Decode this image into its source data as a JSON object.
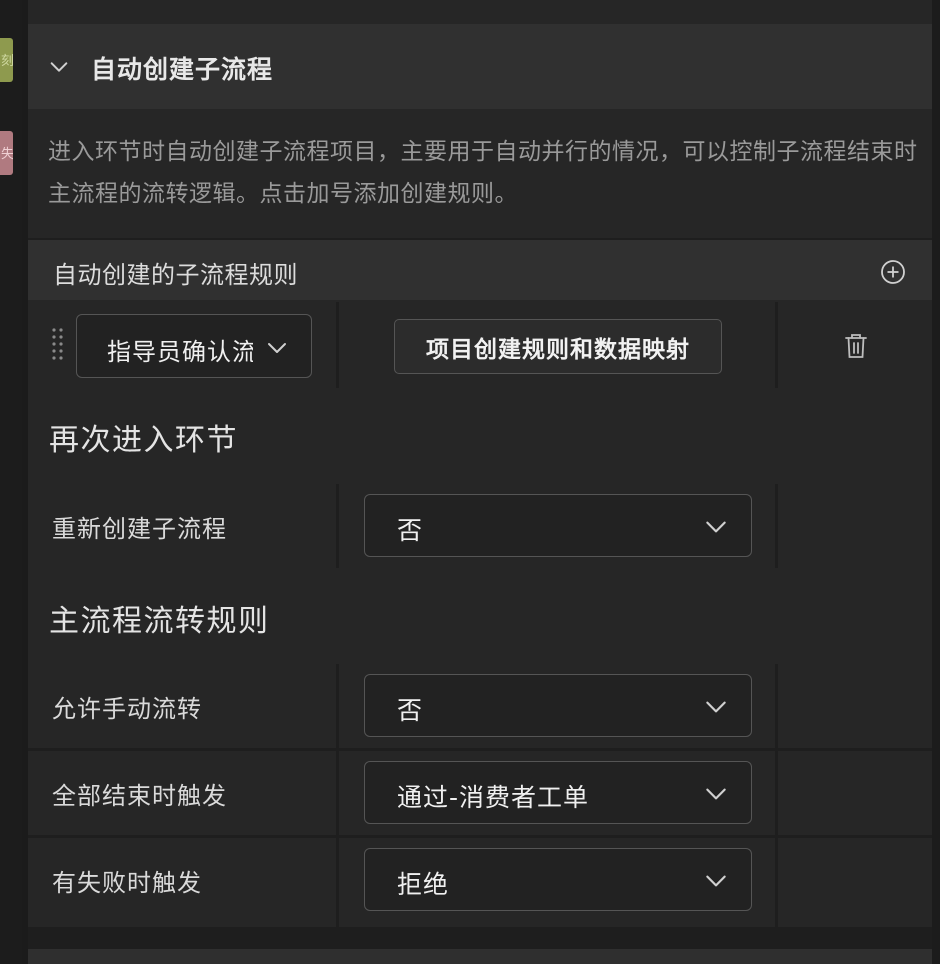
{
  "gutter": {
    "stub_top": "刻",
    "stub_bottom": "失"
  },
  "section": {
    "title": "自动创建子流程"
  },
  "description": "进入环节时自动创建子流程项目，主要用于自动并行的情况，可以控制子流程结束时主流程的流转逻辑。点击加号添加创建规则。",
  "rules": {
    "title": "自动创建的子流程规则",
    "items": [
      {
        "route": "指导员确认流",
        "mapping_button": "项目创建规则和数据映射"
      }
    ]
  },
  "reenter": {
    "heading": "再次进入环节",
    "fields": [
      {
        "label": "重新创建子流程",
        "value": "否"
      }
    ]
  },
  "main_flow": {
    "heading": "主流程流转规则",
    "fields": [
      {
        "label": "允许手动流转",
        "value": "否"
      },
      {
        "label": "全部结束时触发",
        "value": "通过-消费者工单"
      },
      {
        "label": "有失败时触发",
        "value": "拒绝"
      }
    ]
  },
  "icons": {
    "collapse": "chevron-down-icon",
    "add": "plus-circle-icon",
    "drag": "drag-handle-icon",
    "dropdown": "chevron-down-icon",
    "delete": "trash-icon"
  }
}
